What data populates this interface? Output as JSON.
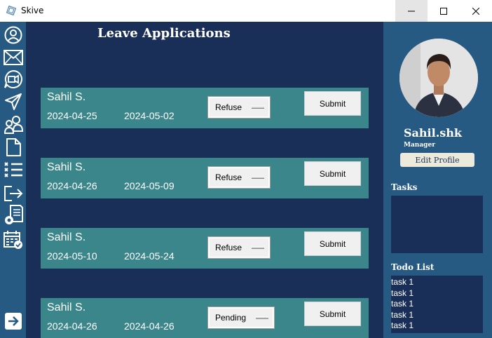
{
  "window": {
    "title": "Skive"
  },
  "main": {
    "heading": "Leave Applications",
    "applications": [
      {
        "name": "Sahil S.",
        "from": "2024-04-25",
        "to": "2024-05-02",
        "status": "Refuse",
        "submit_label": "Submit"
      },
      {
        "name": "Sahil S.",
        "from": "2024-04-26",
        "to": "2024-05-09",
        "status": "Refuse",
        "submit_label": "Submit"
      },
      {
        "name": "Sahil S.",
        "from": "2024-05-10",
        "to": "2024-05-24",
        "status": "Refuse",
        "submit_label": "Submit"
      },
      {
        "name": "Sahil S.",
        "from": "2024-04-26",
        "to": "2024-04-26",
        "status": "Pending",
        "submit_label": "Submit"
      }
    ]
  },
  "profile": {
    "username": "Sahil.shk",
    "role": "Manager",
    "edit_label": "Edit Profile"
  },
  "tasks": {
    "label": "Tasks"
  },
  "todo": {
    "label": "Todo List",
    "items": [
      "task 1",
      "task 1",
      "task 1",
      "task 1",
      "task 1"
    ]
  },
  "sidebar": {
    "icons": [
      "profile-icon",
      "mail-icon",
      "video-call-icon",
      "send-icon",
      "users-icon",
      "document-icon",
      "checklist-icon",
      "logout-icon",
      "settings-document-icon",
      "calendar-check-icon",
      "expand-icon"
    ]
  },
  "colors": {
    "main_bg": "#1a2f57",
    "panel_bg": "#275a83",
    "card_bg": "#3a868b",
    "button_bg": "#eceadb"
  }
}
